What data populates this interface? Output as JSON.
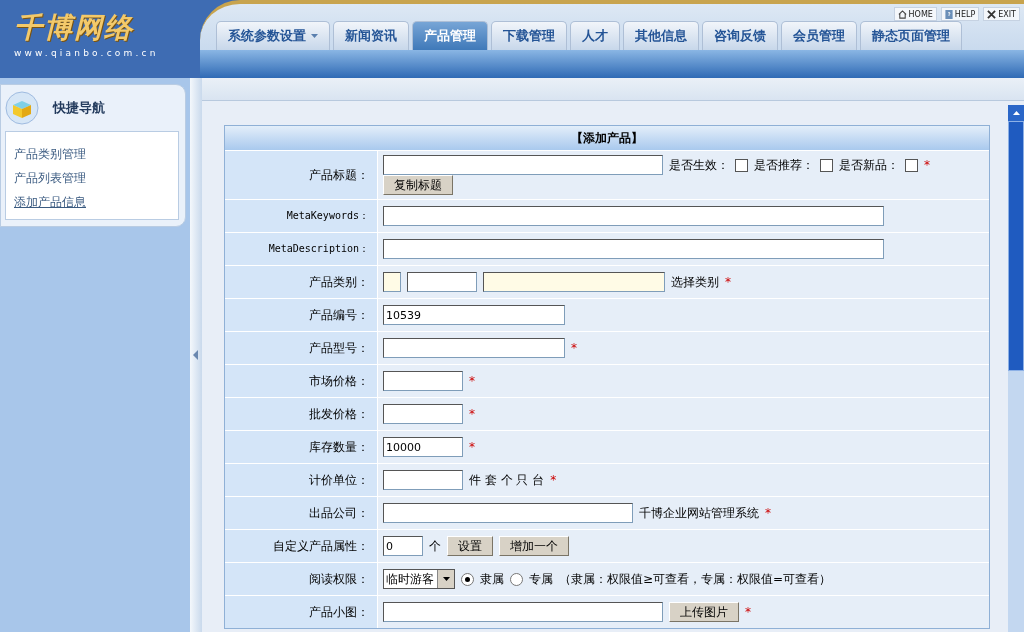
{
  "logo": {
    "name": "千博网络",
    "url": "www.qianbo.com.cn"
  },
  "top_links": [
    {
      "kind": "home",
      "label": "HOME"
    },
    {
      "kind": "help",
      "label": "HELP"
    },
    {
      "kind": "exit",
      "label": "EXIT"
    }
  ],
  "tabs": [
    {
      "label": "系统参数设置",
      "has_menu": true,
      "selected": false
    },
    {
      "label": "新闻资讯",
      "has_menu": false,
      "selected": false
    },
    {
      "label": "产品管理",
      "has_menu": false,
      "selected": true
    },
    {
      "label": "下载管理",
      "has_menu": false,
      "selected": false
    },
    {
      "label": "人才",
      "has_menu": false,
      "selected": false
    },
    {
      "label": "其他信息",
      "has_menu": false,
      "selected": false
    },
    {
      "label": "咨询反馈",
      "has_menu": false,
      "selected": false
    },
    {
      "label": "会员管理",
      "has_menu": false,
      "selected": false
    },
    {
      "label": "静态页面管理",
      "has_menu": false,
      "selected": false
    }
  ],
  "sidebar": {
    "title": "快捷导航",
    "items": [
      {
        "label": "产品类别管理",
        "selected": false
      },
      {
        "label": "产品列表管理",
        "selected": false
      },
      {
        "label": "添加产品信息",
        "selected": true
      }
    ]
  },
  "form": {
    "title": "【添加产品】",
    "rows": [
      {
        "label": "产品标题：",
        "parts": [
          {
            "kind": "long-field"
          },
          {
            "kind": "text",
            "text": "是否生效："
          },
          {
            "kind": "checkbox",
            "checked": false
          },
          {
            "kind": "text",
            "text": "是否推荐："
          },
          {
            "kind": "checkbox",
            "checked": false
          },
          {
            "kind": "text",
            "text": "是否新品："
          },
          {
            "kind": "checkbox",
            "checked": false
          },
          {
            "kind": "required",
            "text": "*"
          },
          {
            "kind": "break"
          },
          {
            "kind": "button",
            "text": "复制标题"
          }
        ]
      },
      {
        "label": "MetaKeywords：",
        "parts": [
          {
            "kind": "full-field"
          }
        ]
      },
      {
        "label": "MetaDescription：",
        "parts": [
          {
            "kind": "full-field"
          }
        ]
      },
      {
        "label": "产品类别：",
        "parts": [
          {
            "kind": "stub-field",
            "readonly": true
          },
          {
            "kind": "narrow-field",
            "readonly": false
          },
          {
            "kind": "mid-field",
            "readonly": true
          },
          {
            "kind": "text",
            "text": "选择类别"
          },
          {
            "kind": "required",
            "text": "*"
          }
        ]
      },
      {
        "label": "产品编号：",
        "parts": [
          {
            "kind": "mid-field",
            "value": "10539"
          }
        ]
      },
      {
        "label": "产品型号：",
        "parts": [
          {
            "kind": "mid-field"
          },
          {
            "kind": "required",
            "text": "*"
          }
        ]
      },
      {
        "label": "市场价格：",
        "parts": [
          {
            "kind": "short-field"
          },
          {
            "kind": "required",
            "text": "*"
          }
        ]
      },
      {
        "label": "批发价格：",
        "parts": [
          {
            "kind": "short-field"
          },
          {
            "kind": "required",
            "text": "*"
          }
        ]
      },
      {
        "label": "库存数量：",
        "parts": [
          {
            "kind": "short-field",
            "value": "10000"
          },
          {
            "kind": "required",
            "text": "*"
          }
        ]
      },
      {
        "label": "计价单位：",
        "parts": [
          {
            "kind": "short-field"
          },
          {
            "kind": "text",
            "text": "件 套 个 只 台"
          },
          {
            "kind": "required",
            "text": "*"
          }
        ]
      },
      {
        "label": "出品公司：",
        "parts": [
          {
            "kind": "wide-field"
          },
          {
            "kind": "text",
            "text": "千博企业网站管理系统"
          },
          {
            "kind": "required",
            "text": "*"
          }
        ]
      },
      {
        "label": "自定义产品属性：",
        "parts": [
          {
            "kind": "count-field",
            "value": "0"
          },
          {
            "kind": "text",
            "text": "个"
          },
          {
            "kind": "button",
            "text": "设置"
          },
          {
            "kind": "button",
            "text": "增加一个"
          }
        ]
      },
      {
        "label": "阅读权限：",
        "parts": [
          {
            "kind": "select",
            "value": "临时游客"
          },
          {
            "kind": "radio",
            "text": "隶属",
            "selected": true
          },
          {
            "kind": "radio",
            "text": "专属",
            "selected": false
          },
          {
            "kind": "text",
            "text": "（隶属：权限值≥可查看，专属：权限值=可查看）"
          }
        ]
      },
      {
        "label": "产品小图：",
        "parts": [
          {
            "kind": "long-field"
          },
          {
            "kind": "button",
            "text": "上传图片"
          },
          {
            "kind": "required",
            "text": "*"
          }
        ]
      }
    ]
  }
}
